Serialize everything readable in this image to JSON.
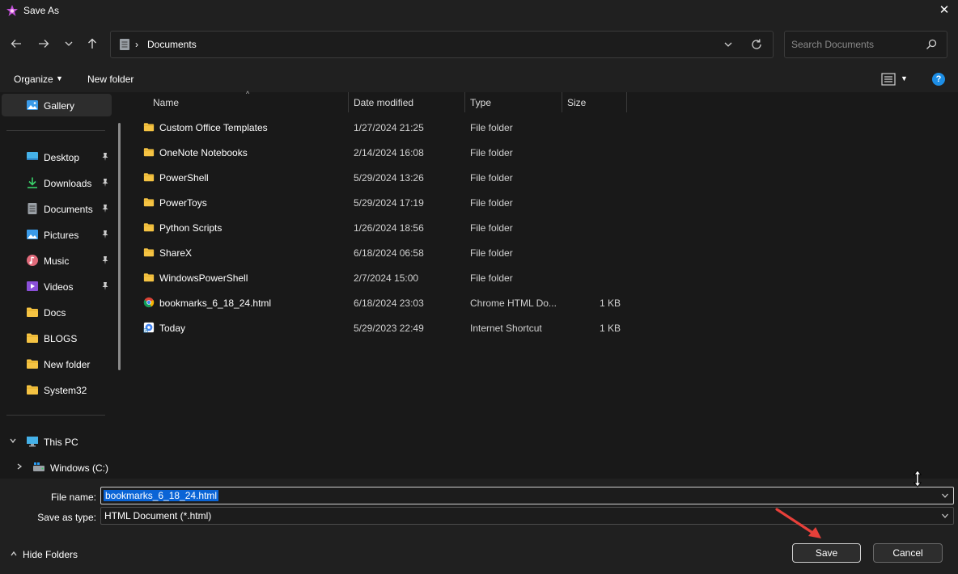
{
  "window": {
    "title": "Save As",
    "close_glyph": "✕"
  },
  "nav": {
    "back_label": "Back",
    "forward_label": "Forward",
    "address": {
      "separator": "›",
      "crumb": "Documents"
    },
    "search_placeholder": "Search Documents"
  },
  "command_bar": {
    "organize": "Organize",
    "new_folder": "New folder",
    "help": "?"
  },
  "sidebar": {
    "gallery": "Gallery",
    "quick_access": [
      {
        "label": "Desktop",
        "icon": "desktop-icon",
        "pinned": true
      },
      {
        "label": "Downloads",
        "icon": "downloads-icon",
        "pinned": true
      },
      {
        "label": "Documents",
        "icon": "documents-icon",
        "pinned": true
      },
      {
        "label": "Pictures",
        "icon": "pictures-icon",
        "pinned": true
      },
      {
        "label": "Music",
        "icon": "music-icon",
        "pinned": true
      },
      {
        "label": "Videos",
        "icon": "videos-icon",
        "pinned": true
      },
      {
        "label": "Docs",
        "icon": "folder-icon",
        "pinned": false
      },
      {
        "label": "BLOGS",
        "icon": "folder-icon",
        "pinned": false
      },
      {
        "label": "New folder",
        "icon": "folder-icon",
        "pinned": false
      },
      {
        "label": "System32",
        "icon": "folder-icon",
        "pinned": false
      }
    ],
    "this_pc": "This PC",
    "windows_drive": "Windows (C:)"
  },
  "columns": {
    "name": "Name",
    "date": "Date modified",
    "type": "Type",
    "size": "Size"
  },
  "files": [
    {
      "name": "Custom Office Templates",
      "date": "1/27/2024 21:25",
      "type": "File folder",
      "size": "",
      "icon": "folder-icon"
    },
    {
      "name": "OneNote Notebooks",
      "date": "2/14/2024 16:08",
      "type": "File folder",
      "size": "",
      "icon": "folder-icon"
    },
    {
      "name": "PowerShell",
      "date": "5/29/2024 13:26",
      "type": "File folder",
      "size": "",
      "icon": "folder-icon"
    },
    {
      "name": "PowerToys",
      "date": "5/29/2024 17:19",
      "type": "File folder",
      "size": "",
      "icon": "folder-icon"
    },
    {
      "name": "Python Scripts",
      "date": "1/26/2024 18:56",
      "type": "File folder",
      "size": "",
      "icon": "folder-icon"
    },
    {
      "name": "ShareX",
      "date": "6/18/2024 06:58",
      "type": "File folder",
      "size": "",
      "icon": "folder-icon"
    },
    {
      "name": "WindowsPowerShell",
      "date": "2/7/2024 15:00",
      "type": "File folder",
      "size": "",
      "icon": "folder-icon"
    },
    {
      "name": "bookmarks_6_18_24.html",
      "date": "6/18/2024 23:03",
      "type": "Chrome HTML Do...",
      "size": "1 KB",
      "icon": "chrome-icon"
    },
    {
      "name": "Today",
      "date": "5/29/2023 22:49",
      "type": "Internet Shortcut",
      "size": "1 KB",
      "icon": "shortcut-icon"
    }
  ],
  "form": {
    "file_name_label": "File name:",
    "file_name_value": "bookmarks_6_18_24.html",
    "save_type_label": "Save as type:",
    "save_type_value": "HTML Document (*.html)"
  },
  "footer": {
    "hide_folders": "Hide Folders",
    "save": "Save",
    "cancel": "Cancel"
  },
  "colors": {
    "folder": "#f5c343",
    "accent": "#0a64d6",
    "help": "#1d8ee6",
    "annotation_arrow": "#e8403a"
  }
}
